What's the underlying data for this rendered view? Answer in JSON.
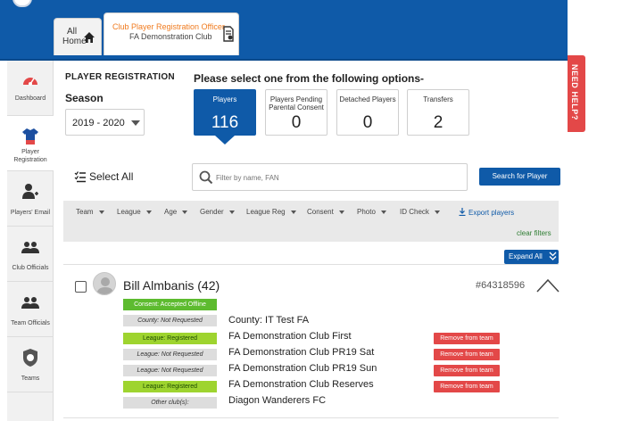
{
  "header": {
    "home_tab": {
      "line1": "All",
      "line2": "Home"
    },
    "role_tab": {
      "title": "Club Player Registration Officer",
      "club": "FA Demonstration Club"
    }
  },
  "help_tab": "NEED HELP?",
  "sidebar": {
    "items": [
      {
        "label": "Dashboard",
        "icon": "dashboard-icon"
      },
      {
        "label": "Player Registration",
        "icon": "shirt-icon",
        "active": true
      },
      {
        "label": "Players' Email",
        "icon": "user-add-icon"
      },
      {
        "label": "Club Officials",
        "icon": "group-icon"
      },
      {
        "label": "Team Officials",
        "icon": "group-icon"
      },
      {
        "label": "Teams",
        "icon": "badge-ball-icon"
      }
    ]
  },
  "main": {
    "section_title": "PLAYER REGISTRATION",
    "season_label": "Season",
    "season_value": "2019 - 2020",
    "options_title": "Please select one from the following options-",
    "options": [
      {
        "label": "Players",
        "value": "116",
        "active": true
      },
      {
        "label": "Players Pending Parental Consent",
        "value": "0"
      },
      {
        "label": "Detached Players",
        "value": "0"
      },
      {
        "label": "Transfers",
        "value": "2"
      }
    ],
    "select_all": "Select All",
    "search_placeholder": "Filter by name, FAN",
    "search_button": "Search for Player",
    "filters": [
      "Team",
      "League",
      "Age",
      "Gender",
      "League Reg",
      "Consent",
      "Photo",
      "ID Check"
    ],
    "export": "Export players",
    "clear_filters": "clear filters",
    "expand_all": "Expand All"
  },
  "player": {
    "name": "Bill Almbanis (42)",
    "fan": "#64318596",
    "consent": "Consent: Accepted Offline",
    "rows": [
      {
        "status": "County: Not Requested",
        "text": "County: IT Test FA",
        "kind": "grey",
        "remove": ""
      },
      {
        "status": "League: Registered",
        "text": "FA Demonstration Club First",
        "kind": "lime",
        "remove": "Remove from team"
      },
      {
        "status": "League: Not Requested",
        "text": "FA Demonstration Club PR19 Sat",
        "kind": "grey",
        "remove": "Remove from team"
      },
      {
        "status": "League: Not Requested",
        "text": "FA Demonstration Club PR19 Sun",
        "kind": "grey",
        "remove": "Remove from team"
      },
      {
        "status": "League: Registered",
        "text": "FA Demonstration Club Reserves",
        "kind": "lime",
        "remove": "Remove from team"
      },
      {
        "status": "Other club(s):",
        "text": "Diagon Wanderers FC",
        "kind": "grey",
        "remove": ""
      }
    ]
  },
  "colors": {
    "brand_blue": "#0f5aa8",
    "help_red": "#e34848",
    "remove_red": "#e34848",
    "registered_lime": "#9ed42f",
    "consent_green": "#5dbb2f",
    "orange_title": "#f07b1f"
  }
}
